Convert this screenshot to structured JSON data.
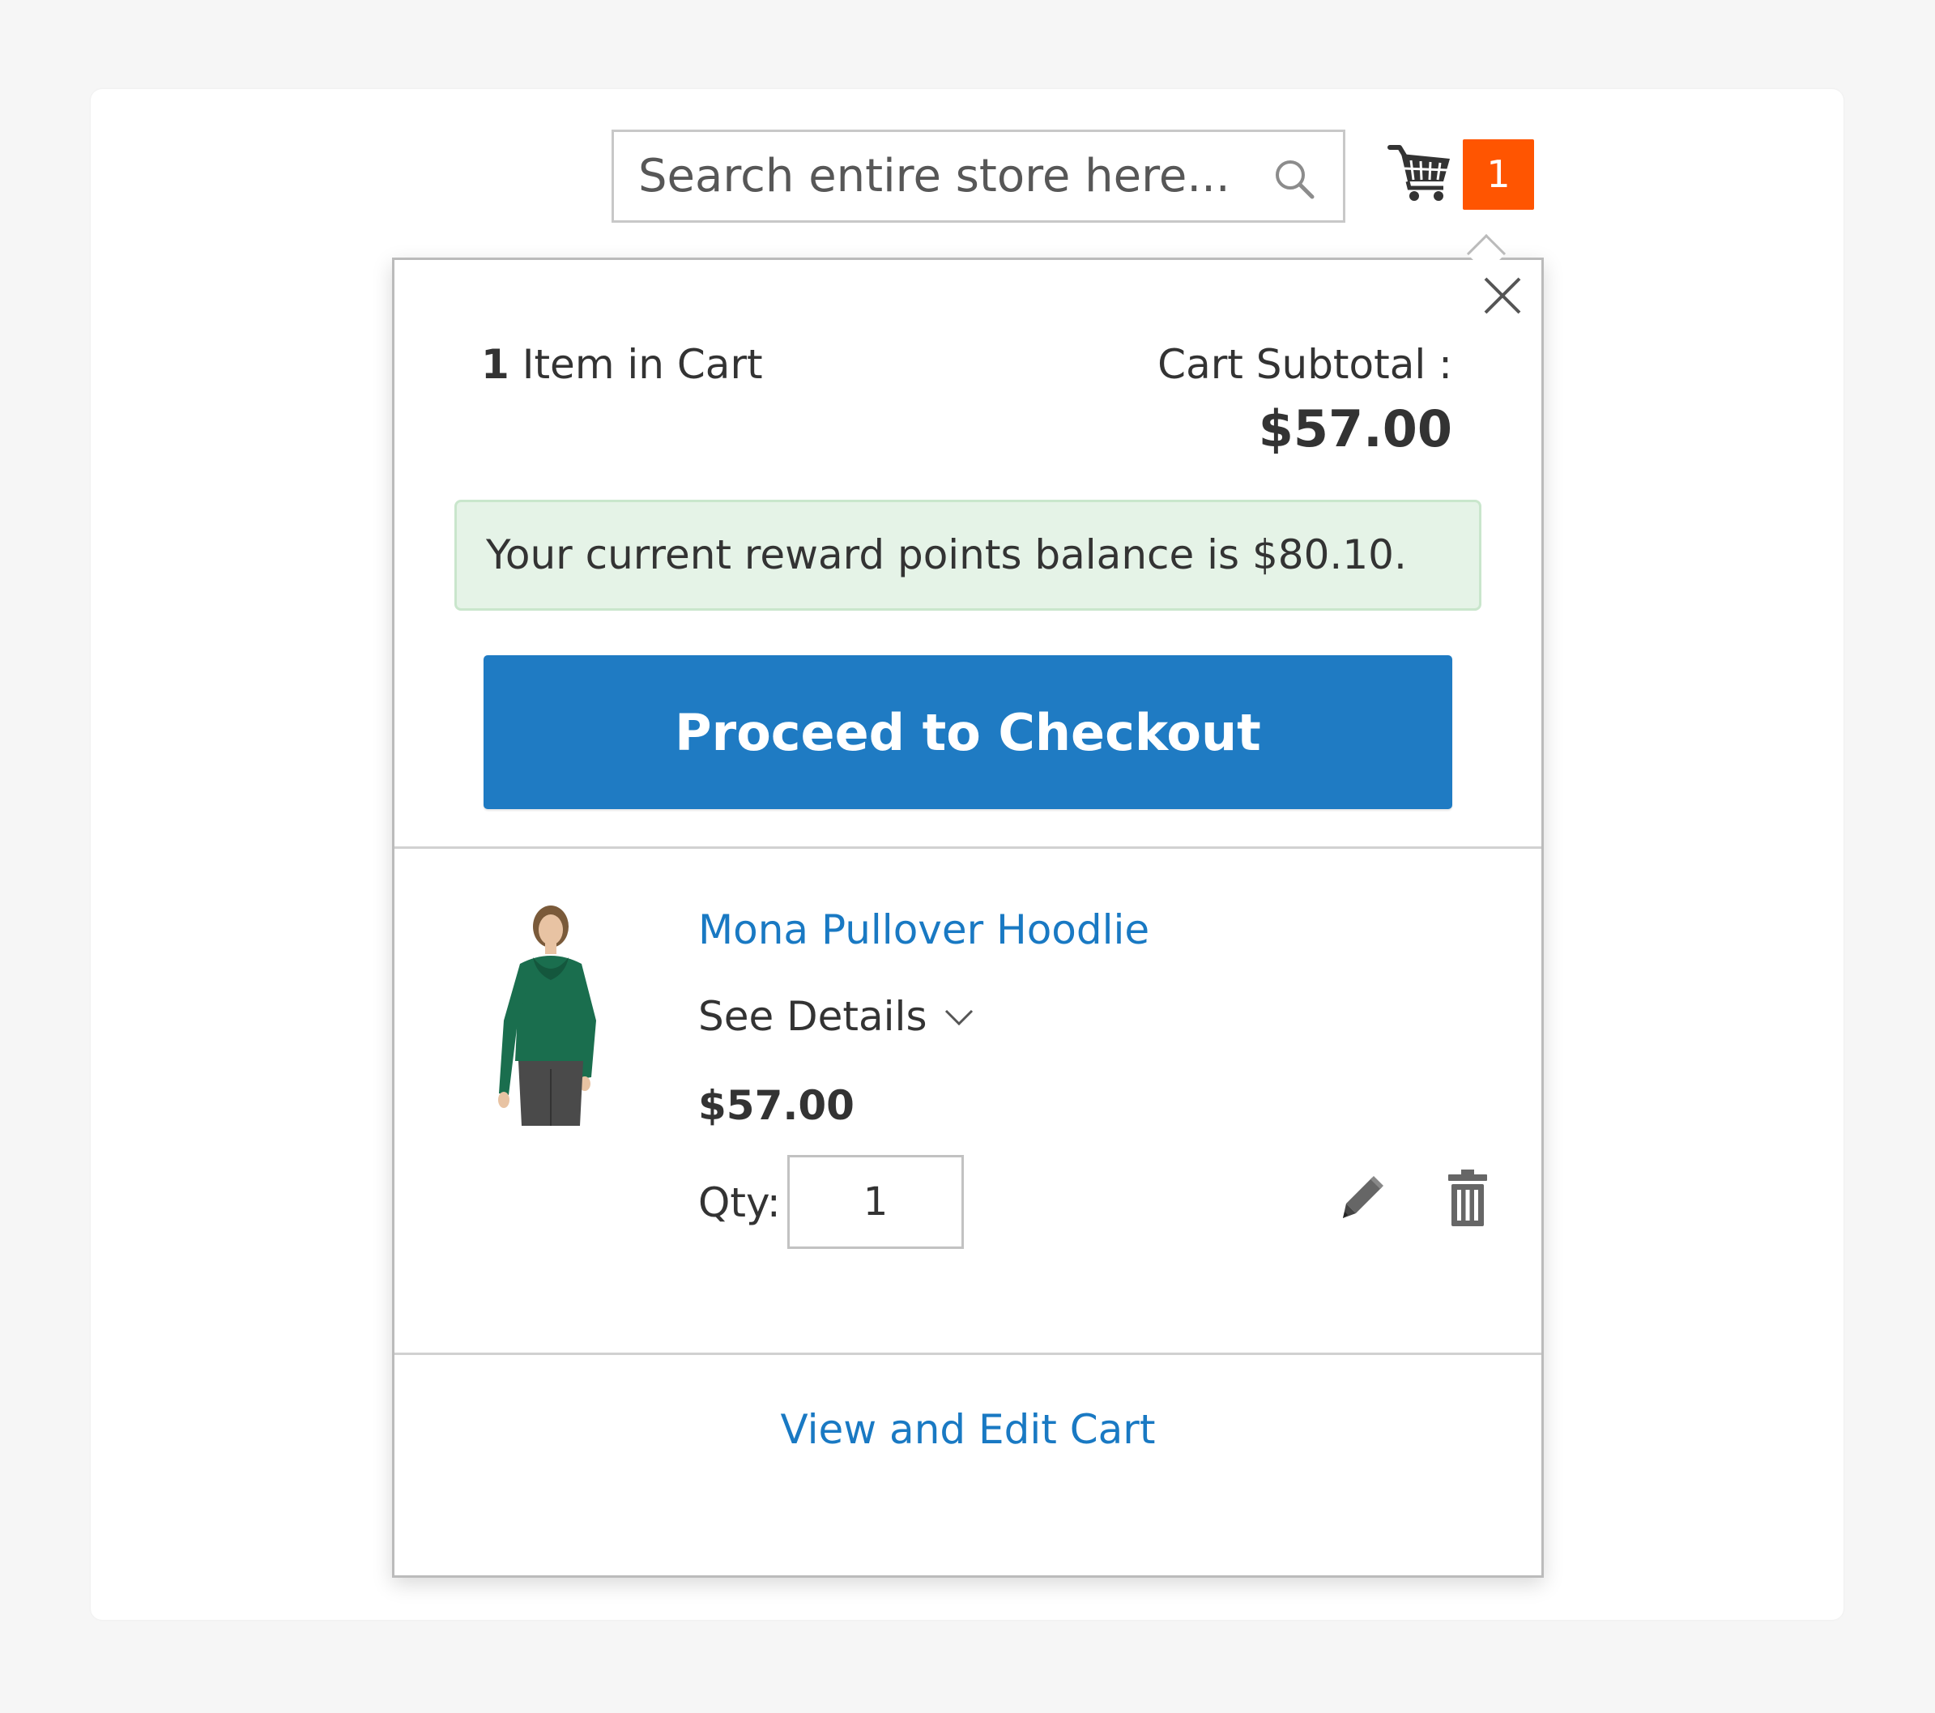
{
  "header": {
    "search": {
      "placeholder": "Search entire store here...",
      "value": ""
    },
    "cart": {
      "counter": "1"
    }
  },
  "minicart": {
    "items_count": "1",
    "items_label": "Item in Cart",
    "subtotal_label": "Cart Subtotal :",
    "subtotal_amount": "$57.00",
    "reward_message": "Your current reward points balance is $80.10.",
    "checkout_button": "Proceed to Checkout",
    "item": {
      "name": "Mona Pullover Hoodlie",
      "see_details": "See Details",
      "price": "$57.00",
      "qty_label": "Qty:",
      "qty": "1"
    },
    "view_cart_link": "View and Edit Cart"
  },
  "colors": {
    "accent_blue": "#1f7bc3",
    "link_blue": "#1979c3",
    "counter_orange": "#ff5501",
    "reward_bg": "#e5f3e7"
  },
  "icons": [
    "search-icon",
    "cart-icon",
    "close-icon",
    "chevron-down-icon",
    "edit-icon",
    "trash-icon"
  ]
}
